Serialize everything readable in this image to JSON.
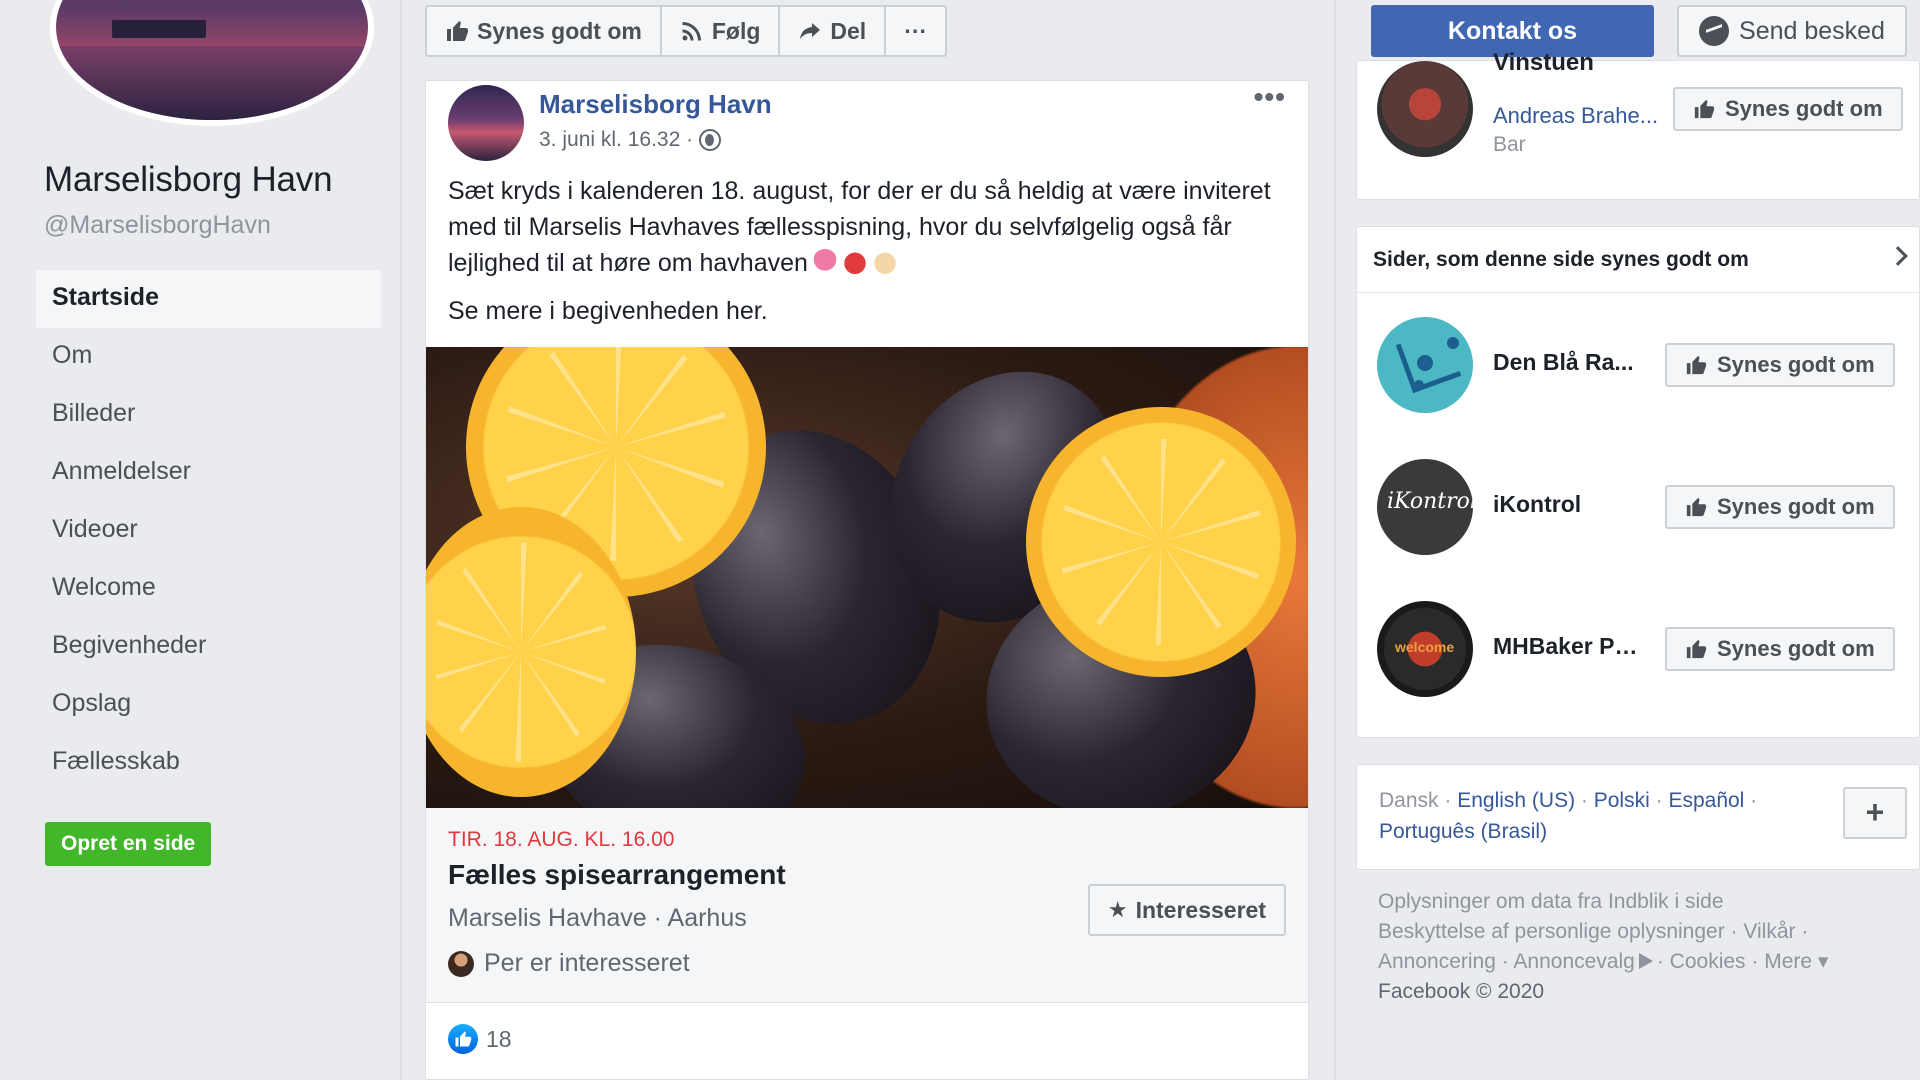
{
  "page": {
    "name": "Marselisborg Havn",
    "handle": "@MarselisborgHavn"
  },
  "nav": {
    "items": [
      {
        "label": "Startside"
      },
      {
        "label": "Om"
      },
      {
        "label": "Billeder"
      },
      {
        "label": "Anmeldelser"
      },
      {
        "label": "Videoer"
      },
      {
        "label": "Welcome"
      },
      {
        "label": "Begivenheder"
      },
      {
        "label": "Opslag"
      },
      {
        "label": "Fællesskab"
      }
    ],
    "active_index": 0,
    "create_page": "Opret en side"
  },
  "actions": {
    "like": "Synes godt om",
    "follow": "Følg",
    "share": "Del",
    "more": "···",
    "contact": "Kontakt os",
    "message": "Send besked"
  },
  "post": {
    "author": "Marselisborg Havn",
    "date": "3. juni kl. 16.32 ·",
    "more": "•••",
    "text_1": "Sæt kryds i kalenderen 18. august, for der er du så heldig at være inviteret med til Marselis Havhaves fællesspisning, hvor du selvfølgelig også får lejlighed til at høre om havhaven",
    "text_2": "Se mere i begivenheden her.",
    "event": {
      "date": "TIR. 18. AUG. KL. 16.00",
      "title": "Fælles spisearrangement",
      "place": "Marselis Havhave · Aarhus",
      "interested_text": "Per er interesseret",
      "interested_button": "Interesseret"
    },
    "likes_count": "18"
  },
  "right": {
    "top_card": {
      "title": "Vinstuen",
      "subtitle": "Andreas Brahe...",
      "category": "Bar",
      "like_button": "Synes godt om"
    },
    "liked_pages": {
      "header": "Sider, som denne side synes godt om",
      "items": [
        {
          "name": "Den Blå Ra...",
          "like_button": "Synes godt om"
        },
        {
          "name": "iKontrol",
          "like_button": "Synes godt om",
          "avatar_text": "iKontrol"
        },
        {
          "name": "MHBaker Ph...",
          "like_button": "Synes godt om",
          "avatar_text": "welcome"
        }
      ]
    },
    "languages": {
      "current": "Dansk",
      "others": [
        "English (US)",
        "Polski",
        "Español",
        "Português (Brasil)"
      ],
      "sep": " · ",
      "add": "+"
    },
    "footer": {
      "line_1": "Oplysninger om data fra Indblik i side",
      "line_2": "Beskyttelse af personlige oplysninger · Vilkår ·",
      "line_3a": "Annoncering · Annoncevalg",
      "line_3b": "· Cookies · Mere ▾",
      "copyright": "Facebook © 2020"
    }
  },
  "colors": {
    "brand_blue": "#4267b2",
    "link_blue": "#365899",
    "green": "#42b72a",
    "event_red": "#e0383e",
    "background": "#e9ebee"
  }
}
